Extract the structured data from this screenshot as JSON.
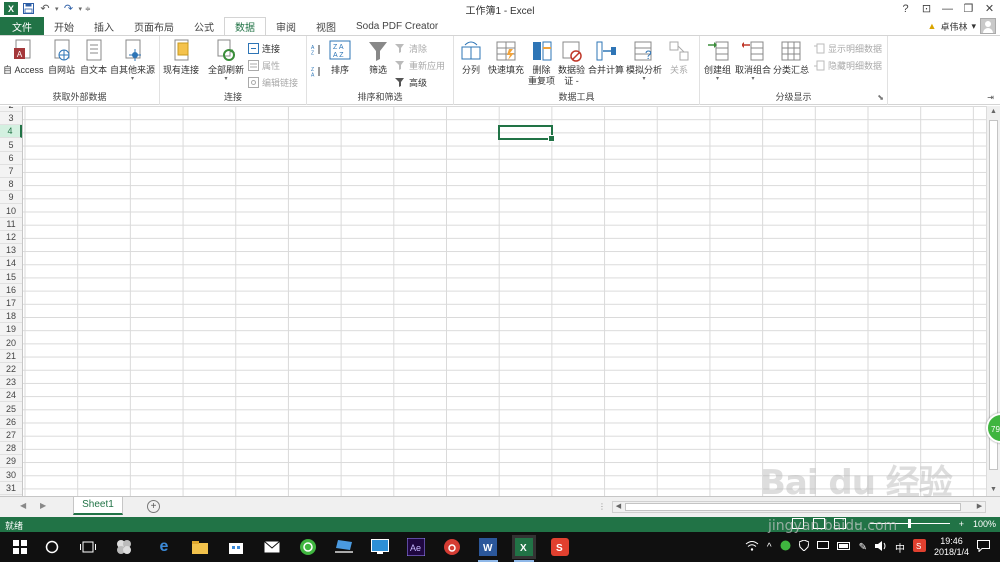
{
  "window": {
    "title": "工作簿1 - Excel",
    "help": "?",
    "ribbon_options": "⊡",
    "minimize": "—",
    "restore": "❐",
    "close": "✕"
  },
  "qat": {
    "logo": "X",
    "save_icon": "save-icon",
    "undo_icon": "undo-icon",
    "redo_icon": "redo-icon"
  },
  "tabs": [
    {
      "label": "文件"
    },
    {
      "label": "开始"
    },
    {
      "label": "插入"
    },
    {
      "label": "页面布局"
    },
    {
      "label": "公式"
    },
    {
      "label": "数据"
    },
    {
      "label": "审阅"
    },
    {
      "label": "视图"
    },
    {
      "label": "Soda PDF Creator"
    }
  ],
  "user": {
    "name": "卓伟林",
    "caret": "▾"
  },
  "ribbon": {
    "get_external": {
      "label": "获取外部数据",
      "access": "自 Access",
      "web": "自网站",
      "text": "自文本",
      "other": "自其他来源"
    },
    "connections": {
      "label": "连接",
      "existing": "现有连接",
      "refresh_all": "全部刷新",
      "connect": "连接",
      "properties": "属性",
      "edit_links": "编辑链接"
    },
    "sort_filter": {
      "label": "排序和筛选",
      "sort": "排序",
      "filter": "筛选",
      "clear": "清除",
      "reapply": "重新应用",
      "advanced": "高级"
    },
    "data_tools": {
      "label": "数据工具",
      "split": "分列",
      "flash_fill": "快速填充",
      "remove_dup_1": "删除",
      "remove_dup_2": "重复项",
      "validation_1": "数据验",
      "validation_2": "证 -",
      "consolidate": "合并计算",
      "what_if": "模拟分析",
      "relations": "关系"
    },
    "outline": {
      "label": "分级显示",
      "group": "创建组",
      "ungroup": "取消组合",
      "subtotal": "分类汇总",
      "show_detail": "显示明细数据",
      "hide_detail": "隐藏明细数据"
    }
  },
  "rows": [
    "2",
    "3",
    "4",
    "5",
    "6",
    "7",
    "8",
    "9",
    "10",
    "11",
    "12",
    "13",
    "14",
    "15",
    "16",
    "17",
    "18",
    "19",
    "20",
    "21",
    "22",
    "23",
    "24",
    "25",
    "26",
    "27",
    "28",
    "29",
    "30",
    "31"
  ],
  "selected_row": "4",
  "float_badge": "79",
  "sheet": {
    "tab": "Sheet1",
    "add": "+",
    "prev": "◀",
    "next": "▶"
  },
  "status": {
    "ready": "就绪",
    "zoom": "100%",
    "minus": "−",
    "plus": "+"
  },
  "taskbar": {
    "time": "19:46",
    "date": "2018/1/4",
    "ime": "中"
  },
  "watermark": {
    "brand": "Bai du 经验",
    "url": "jingyan.baidu.com"
  }
}
